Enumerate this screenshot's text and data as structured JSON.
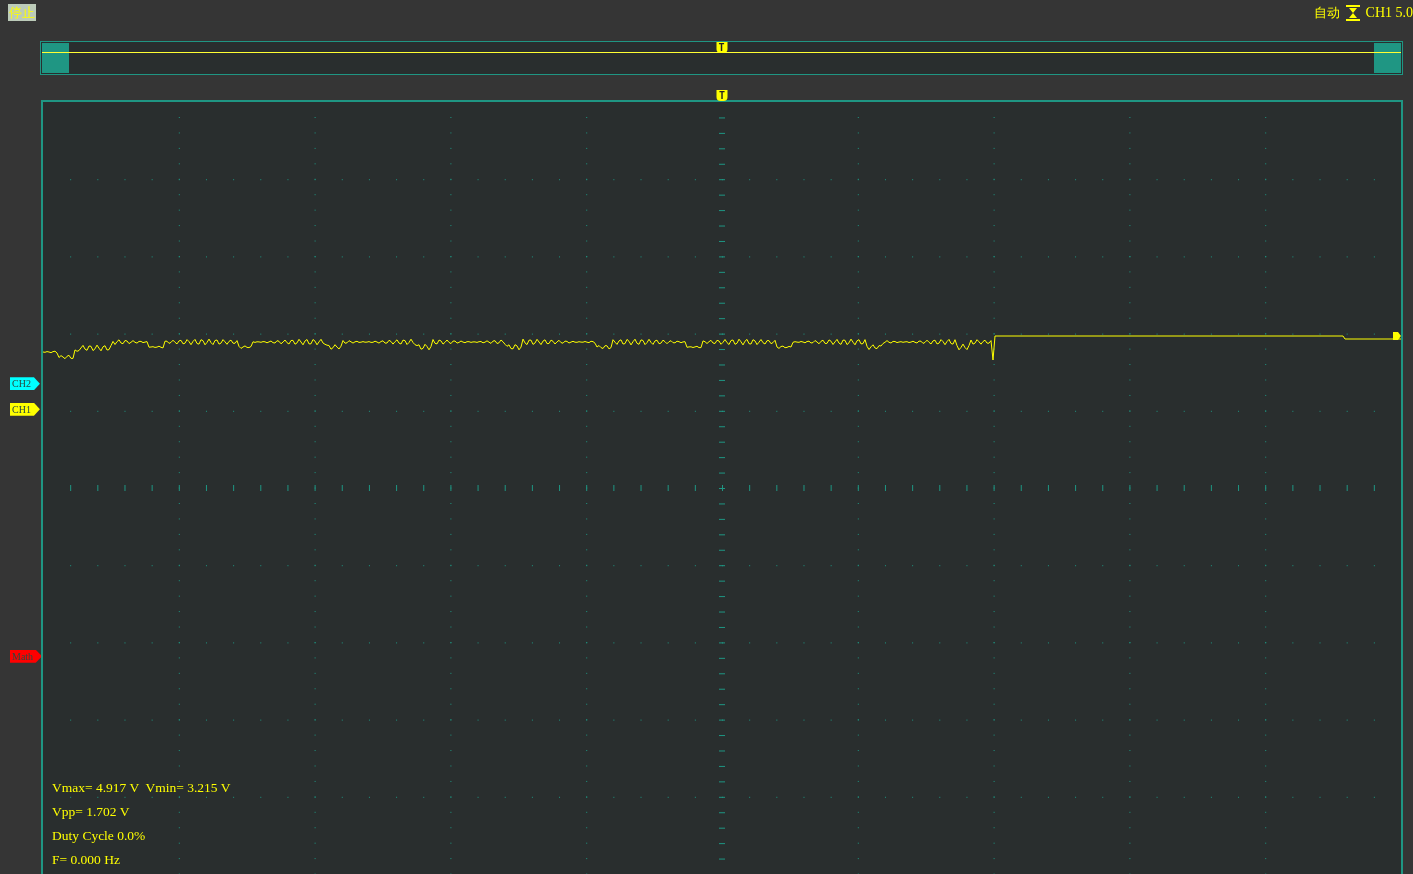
{
  "toolbar": {
    "run_state_button": "停止",
    "trigger_mode": "自动",
    "trigger_source": "CH1 5.0"
  },
  "overview": {
    "trigger_marker": "T"
  },
  "scope": {
    "trigger_marker": "T",
    "channel_markers": [
      {
        "label": "CH2",
        "color": "#00ffff"
      },
      {
        "label": "CH1",
        "color": "#ffff00"
      },
      {
        "label": "Math",
        "color": "#ff0000"
      }
    ],
    "measurements": [
      "Vmax= 4.917 V  Vmin= 3.215 V",
      "Vpp= 1.702 V",
      "Duty Cycle 0.0%",
      "F= 0.000 Hz"
    ]
  }
}
